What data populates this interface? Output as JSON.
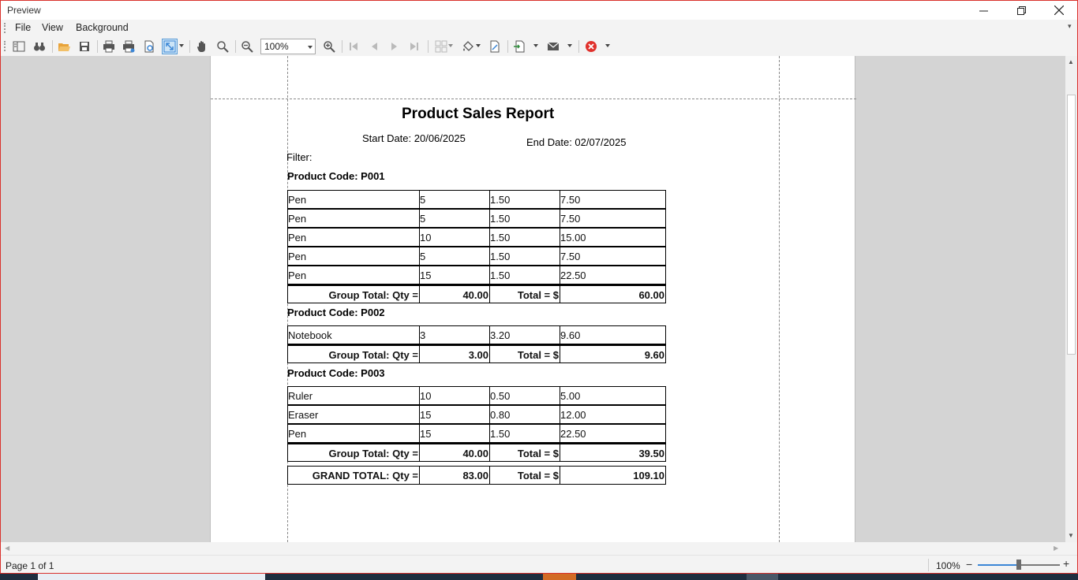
{
  "window": {
    "title": "Preview"
  },
  "menu": {
    "file": "File",
    "view": "View",
    "background": "Background"
  },
  "toolbar": {
    "zoom_value": "100%",
    "icons": [
      "document-map-icon",
      "search-binoculars-icon",
      "open-folder-icon",
      "save-icon",
      "print-icon",
      "quick-print-icon",
      "page-setup-icon",
      "scale-icon",
      "hand-tool-icon",
      "magnifier-icon",
      "zoom-out-icon",
      "zoom-in-icon",
      "first-page-icon",
      "previous-page-icon",
      "next-page-icon",
      "last-page-icon",
      "multiple-pages-icon",
      "fill-background-icon",
      "watermark-icon",
      "export-icon",
      "email-icon",
      "close-preview-icon"
    ]
  },
  "report": {
    "title": "Product Sales Report",
    "start_date": "Start Date: 20/06/2025",
    "end_date": "End Date: 02/07/2025",
    "filter": "Filter:",
    "groups": [
      {
        "header": "Product Code: P001",
        "rows": [
          [
            "Pen",
            "5",
            "1.50",
            "7.50"
          ],
          [
            "Pen",
            "5",
            "1.50",
            "7.50"
          ],
          [
            "Pen",
            "10",
            "1.50",
            "15.00"
          ],
          [
            "Pen",
            "5",
            "1.50",
            "7.50"
          ],
          [
            "Pen",
            "15",
            "1.50",
            "22.50"
          ]
        ],
        "total": {
          "label": "Group Total: Qty =",
          "qty": "40.00",
          "total_label": "Total = $",
          "total": "60.00"
        }
      },
      {
        "header": "Product Code: P002",
        "rows": [
          [
            "Notebook",
            "3",
            "3.20",
            "9.60"
          ]
        ],
        "total": {
          "label": "Group Total: Qty =",
          "qty": "3.00",
          "total_label": "Total = $",
          "total": "9.60"
        }
      },
      {
        "header": "Product Code: P003",
        "rows": [
          [
            "Ruler",
            "10",
            "0.50",
            "5.00"
          ],
          [
            "Eraser",
            "15",
            "0.80",
            "12.00"
          ],
          [
            "Pen",
            "15",
            "1.50",
            "22.50"
          ]
        ],
        "total": {
          "label": "Group Total: Qty =",
          "qty": "40.00",
          "total_label": "Total = $",
          "total": "39.50"
        }
      }
    ],
    "grand_total": {
      "label": "GRAND TOTAL: Qty =",
      "qty": "83.00",
      "total_label": "Total = $",
      "total": "109.10"
    }
  },
  "status": {
    "page_info": "Page 1 of 1",
    "zoom": "100%",
    "zoom_level_fraction": 0.5
  },
  "colors": {
    "window_border": "#d9312c",
    "accent": "#3b86d6",
    "close_red": "#e0312c",
    "folder": "#e8a33a"
  }
}
